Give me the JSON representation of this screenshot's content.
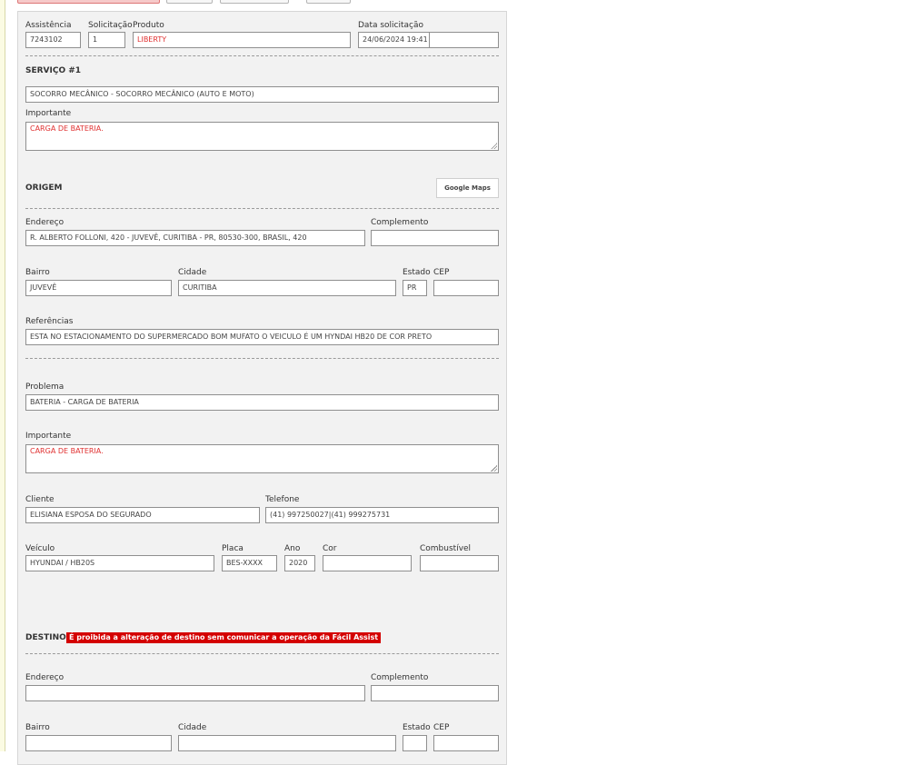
{
  "header": {
    "assistencia_label": "Assistência",
    "assistencia_value": "7243102",
    "solicitacao_label": "Solicitação",
    "solicitacao_value": "1",
    "produto_label": "Produto",
    "produto_value": "LIBERTY",
    "data_label": "Data solicitação",
    "data_value": "24/06/2024 19:41"
  },
  "servico": {
    "title": "SERVIÇO #1",
    "value": "SOCORRO MECÂNICO - SOCORRO MECÂNICO (AUTO E MOTO)",
    "importante_label": "Importante",
    "importante_value": "CARGA DE BATERIA."
  },
  "origem": {
    "title": "ORIGEM",
    "maps_button": "Google Maps",
    "endereco_label": "Endereço",
    "endereco_value": "R. ALBERTO FOLLONI, 420 - JUVEVÊ, CURITIBA - PR, 80530-300, BRASIL, 420",
    "complemento_label": "Complemento",
    "bairro_label": "Bairro",
    "bairro_value": "JUVEVÊ",
    "cidade_label": "Cidade",
    "cidade_value": "CURITIBA",
    "estado_label": "Estado",
    "estado_value": "PR",
    "cep_label": "CEP",
    "referencias_label": "Referências",
    "referencias_value": "ESTA NO ESTACIONAMENTO DO SUPERMERCADO BOM MUFATO O VEICULO É UM HYNDAI HB20 DE COR PRETO"
  },
  "problema": {
    "label": "Problema",
    "value": "BATERIA - CARGA DE BATERIA",
    "importante_label": "Importante",
    "importante_value": "CARGA DE BATERIA."
  },
  "cliente": {
    "label": "Cliente",
    "value": "ELISIANA ESPOSA DO SEGURADO",
    "telefone_label": "Telefone",
    "telefone_value": "(41) 997250027|(41) 999275731"
  },
  "veiculo": {
    "label": "Veículo",
    "value": "HYUNDAI / HB20S",
    "placa_label": "Placa",
    "placa_value": "BES-XXXX",
    "ano_label": "Ano",
    "ano_value": "2020",
    "cor_label": "Cor",
    "combustivel_label": "Combustível"
  },
  "destino": {
    "title": "DESTINO",
    "warning": "É proibida a alteração de destino sem comunicar a operação da Fácil Assist",
    "endereco_label": "Endereço",
    "complemento_label": "Complemento",
    "bairro_label": "Bairro",
    "cidade_label": "Cidade",
    "estado_label": "Estado",
    "cep_label": "CEP"
  }
}
